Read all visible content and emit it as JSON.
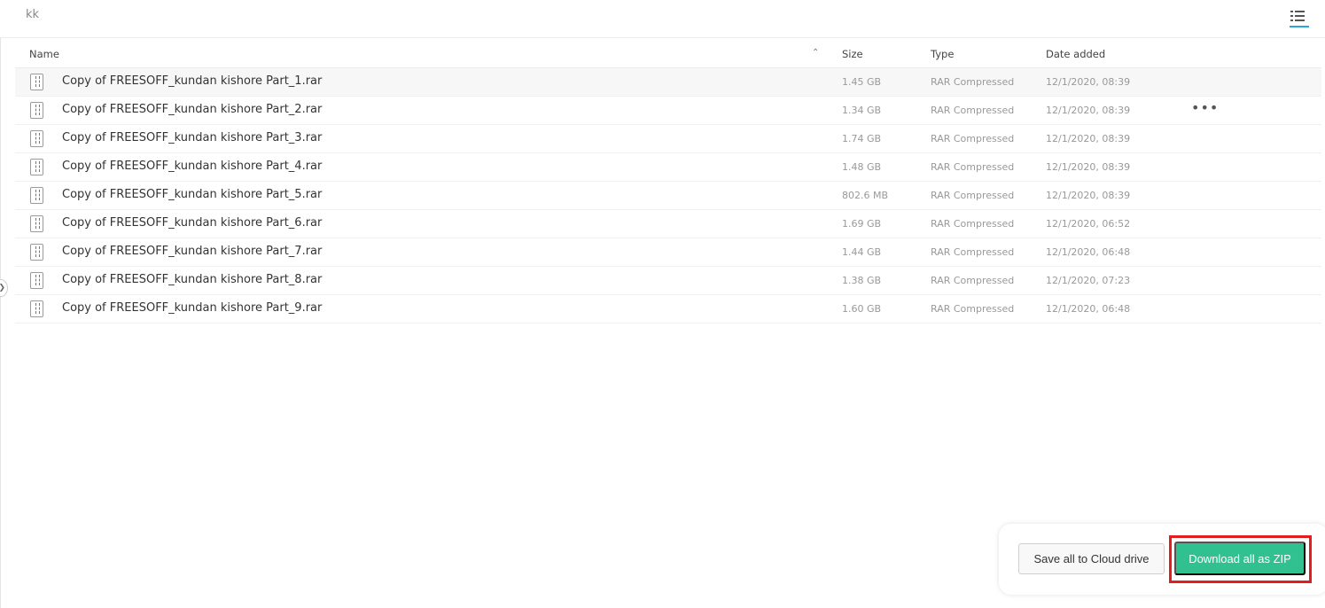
{
  "breadcrumb": {
    "folder": "kk"
  },
  "table": {
    "headers": {
      "name": "Name",
      "size": "Size",
      "type": "Type",
      "date": "Date added"
    },
    "rows": [
      {
        "name": "Copy of FREESOFF_kundan kishore Part_1.rar",
        "size": "1.45 GB",
        "type": "RAR Compressed",
        "date": "12/1/2020, 08:39"
      },
      {
        "name": "Copy of FREESOFF_kundan kishore Part_2.rar",
        "size": "1.34 GB",
        "type": "RAR Compressed",
        "date": "12/1/2020, 08:39"
      },
      {
        "name": "Copy of FREESOFF_kundan kishore Part_3.rar",
        "size": "1.74 GB",
        "type": "RAR Compressed",
        "date": "12/1/2020, 08:39"
      },
      {
        "name": "Copy of FREESOFF_kundan kishore Part_4.rar",
        "size": "1.48 GB",
        "type": "RAR Compressed",
        "date": "12/1/2020, 08:39"
      },
      {
        "name": "Copy of FREESOFF_kundan kishore Part_5.rar",
        "size": "802.6 MB",
        "type": "RAR Compressed",
        "date": "12/1/2020, 08:39"
      },
      {
        "name": "Copy of FREESOFF_kundan kishore Part_6.rar",
        "size": "1.69 GB",
        "type": "RAR Compressed",
        "date": "12/1/2020, 06:52"
      },
      {
        "name": "Copy of FREESOFF_kundan kishore Part_7.rar",
        "size": "1.44 GB",
        "type": "RAR Compressed",
        "date": "12/1/2020, 06:48"
      },
      {
        "name": "Copy of FREESOFF_kundan kishore Part_8.rar",
        "size": "1.38 GB",
        "type": "RAR Compressed",
        "date": "12/1/2020, 07:23"
      },
      {
        "name": "Copy of FREESOFF_kundan kishore Part_9.rar",
        "size": "1.60 GB",
        "type": "RAR Compressed",
        "date": "12/1/2020, 06:48"
      }
    ]
  },
  "actions": {
    "save_cloud": "Save all to Cloud drive",
    "download_zip": "Download all as ZIP"
  },
  "icons": {
    "file": "rar-file-icon",
    "sort": "chevron-up-icon",
    "more": "more-horizontal-icon",
    "view": "list-view-icon",
    "collapse": "chevron-right-icon"
  },
  "colors": {
    "primary_button": "#31c191",
    "highlight": "#e31d1d",
    "view_toggle_active": "#2aa7d8"
  }
}
